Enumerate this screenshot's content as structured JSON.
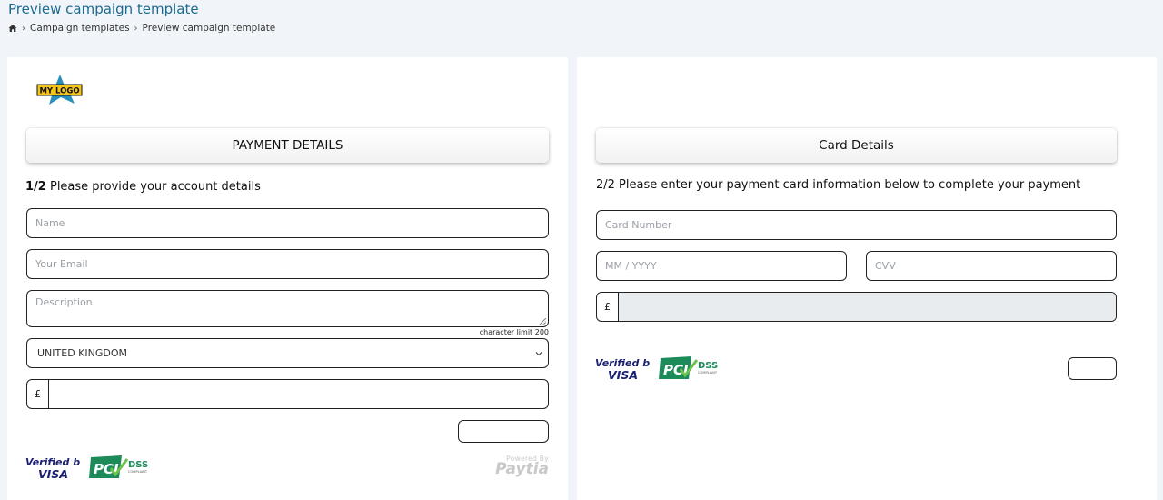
{
  "page": {
    "title": "Preview campaign template",
    "breadcrumb": {
      "home_icon": "home-icon",
      "items": [
        "Campaign templates",
        "Preview campaign template"
      ]
    }
  },
  "left_panel": {
    "logo_text": "MY LOGO",
    "header": "PAYMENT DETAILS",
    "step_number": "1/2",
    "step_text": "Please provide your account details",
    "fields": {
      "name_placeholder": "Name",
      "email_placeholder": "Your Email",
      "description_placeholder": "Description",
      "char_limit": "character limit 200",
      "country_value": "UNITED KINGDOM",
      "currency_symbol": "£"
    },
    "badges": {
      "verified_by": "Verified by",
      "visa": "VISA",
      "pci": "PCI",
      "dss": "DSS",
      "compliant": "COMPLIANT"
    },
    "powered_by": "Powered By",
    "powered_brand": "Paytia"
  },
  "right_panel": {
    "header": "Card Details",
    "step_text": "2/2 Please enter your payment card information below to complete your payment",
    "fields": {
      "card_number_placeholder": "Card Number",
      "expiry_placeholder": "MM / YYYY",
      "cvv_placeholder": "CVV",
      "currency_symbol": "£"
    },
    "badges": {
      "verified_by": "Verified by",
      "visa": "VISA",
      "pci": "PCI",
      "dss": "DSS",
      "compliant": "COMPLIANT"
    }
  },
  "colors": {
    "title": "#1b6a8f",
    "page_bg": "#f1f5f9",
    "visa_blue": "#1a1f71",
    "pci_green": "#1d8a5a"
  }
}
